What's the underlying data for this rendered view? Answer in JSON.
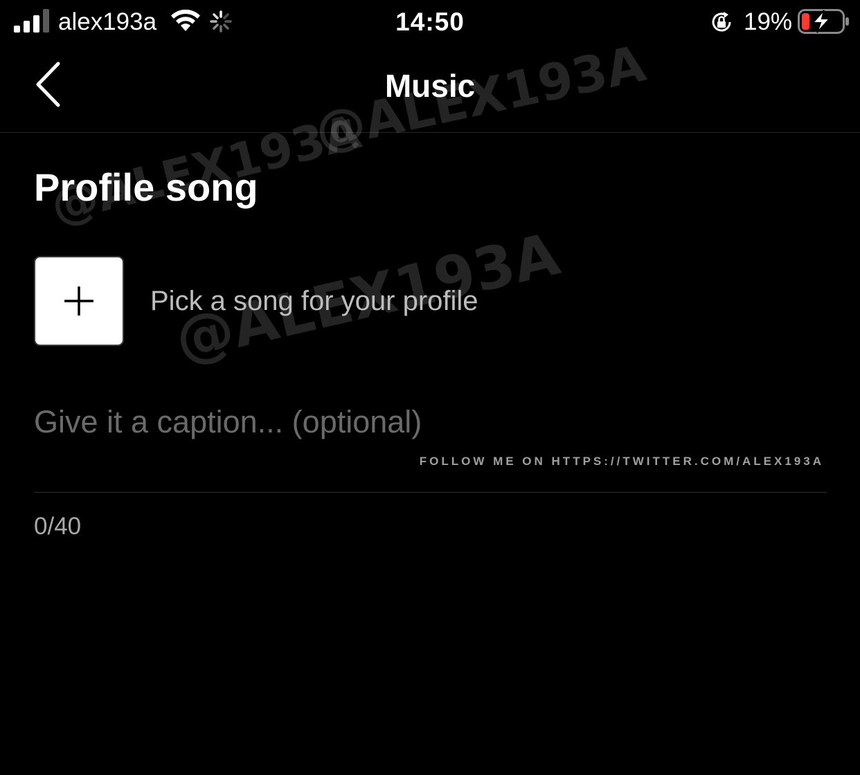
{
  "status_bar": {
    "carrier": "alex193a",
    "time": "14:50",
    "battery_percent": "19%",
    "battery_level": 0.19,
    "battery_low_color": "#ff3b30",
    "icons": [
      "signal-icon",
      "wifi-icon",
      "activity-icon",
      "rotation-lock-icon",
      "battery-charging-icon"
    ]
  },
  "nav": {
    "title": "Music",
    "back_icon": "chevron-left-icon"
  },
  "profile_song": {
    "title": "Profile song",
    "pick_label": "Pick a song for your profile",
    "add_icon": "plus-icon"
  },
  "caption": {
    "value": "",
    "placeholder": "Give it a caption... (optional)",
    "counter": "0/40"
  },
  "watermarks": {
    "handle": "@ALEX193A",
    "follow_text": "FOLLOW ME ON HTTPS://TWITTER.COM/ALEX193A"
  }
}
